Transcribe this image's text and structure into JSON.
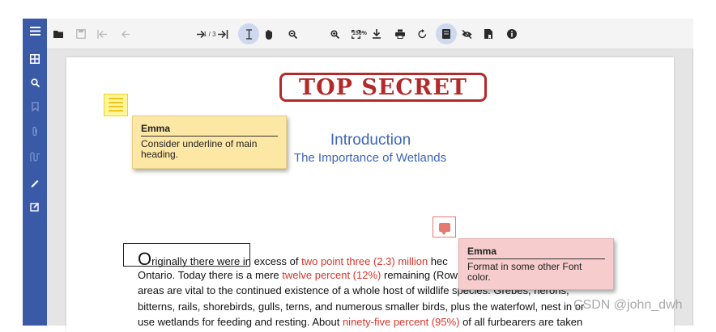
{
  "toolbar": {
    "page_indicator": "1 / 3",
    "zoom_level": "150%"
  },
  "stamp": {
    "text": "TOP SECRET"
  },
  "annotations": {
    "yellow_note": {
      "author": "Emma",
      "text": "Consider underline of main heading."
    },
    "pink_note": {
      "author": "Emma",
      "text": "Format in some other Font color."
    }
  },
  "document": {
    "heading": "Introduction",
    "subheading": "The Importance of Wetlands",
    "lines": [
      {
        "parts": [
          "O",
          "riginally there were ",
          "in excess of ",
          "two point three (2.3) million",
          " hec"
        ]
      },
      {
        "parts": [
          "Ontario. Today there is a mere ",
          "twelve percent (12%)",
          " remaining (Row"
        ]
      },
      {
        "parts": [
          "areas are vital to the continued existence of a whole host of wildlife species. Grebes, herons,"
        ]
      },
      {
        "parts": [
          "bitterns, rails, shorebirds, gulls, terns, and numerous smaller birds, plus the waterfowl, nest in or"
        ]
      },
      {
        "parts": [
          "use wetlands for feeding and resting. About ",
          "ninety-five percent (95%)",
          " of all furbearers are taken"
        ]
      }
    ]
  },
  "watermark": "CSDN @john_dwh",
  "colors": {
    "sidebar": "#3a5aa8",
    "accent_blue": "#3d66b8",
    "highlight_red": "#d9352a",
    "stamp_red": "#b42a2a"
  },
  "icons": {
    "sidebar": [
      "menu-icon",
      "thumbnails-icon",
      "search-icon",
      "bookmark-icon",
      "attachment-icon",
      "signature-icon",
      "annotation-pen-icon",
      "form-edit-icon"
    ],
    "toolbar": [
      "open-folder-icon",
      "save-icon",
      "first-page-icon",
      "previous-page-icon",
      "next-page-icon",
      "last-page-icon",
      "text-select-icon",
      "pan-hand-icon",
      "zoom-out-icon",
      "zoom-in-icon",
      "fit-page-icon",
      "download-icon",
      "print-icon",
      "rotate-icon",
      "annotation-toggle-icon",
      "hide-annotations-icon",
      "bookmark-doc-icon",
      "info-icon"
    ]
  }
}
